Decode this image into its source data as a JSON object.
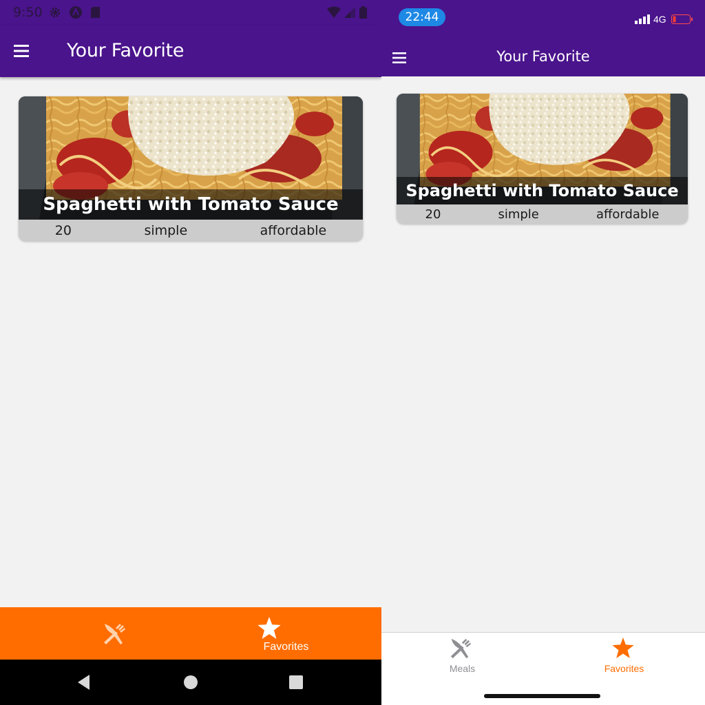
{
  "android": {
    "status_bar": {
      "time": "9:50"
    },
    "header": {
      "title": "Your Favorite"
    },
    "meal_card": {
      "title": "Spaghetti with Tomato Sauce",
      "duration": "20",
      "complexity": "simple",
      "affordability": "affordable"
    },
    "tabs": [
      {
        "label": "",
        "icon": "fork-knife-icon"
      },
      {
        "label": "Favorites",
        "icon": "star-icon"
      }
    ],
    "colors": {
      "primary": "#4a148c",
      "accent": "#ff6d00"
    }
  },
  "ios": {
    "status_bar": {
      "time": "22:44",
      "network": "4G"
    },
    "header": {
      "title": "Your Favorite"
    },
    "meal_card": {
      "title": "Spaghetti with Tomato Sauce",
      "duration": "20",
      "complexity": "simple",
      "affordability": "affordable"
    },
    "tabs": [
      {
        "label": "Meals",
        "icon": "fork-knife-icon"
      },
      {
        "label": "Favorites",
        "icon": "star-icon",
        "active": true
      }
    ],
    "colors": {
      "primary": "#4a148c",
      "accent": "#ff6d00",
      "inactive": "#8e8e93"
    }
  }
}
